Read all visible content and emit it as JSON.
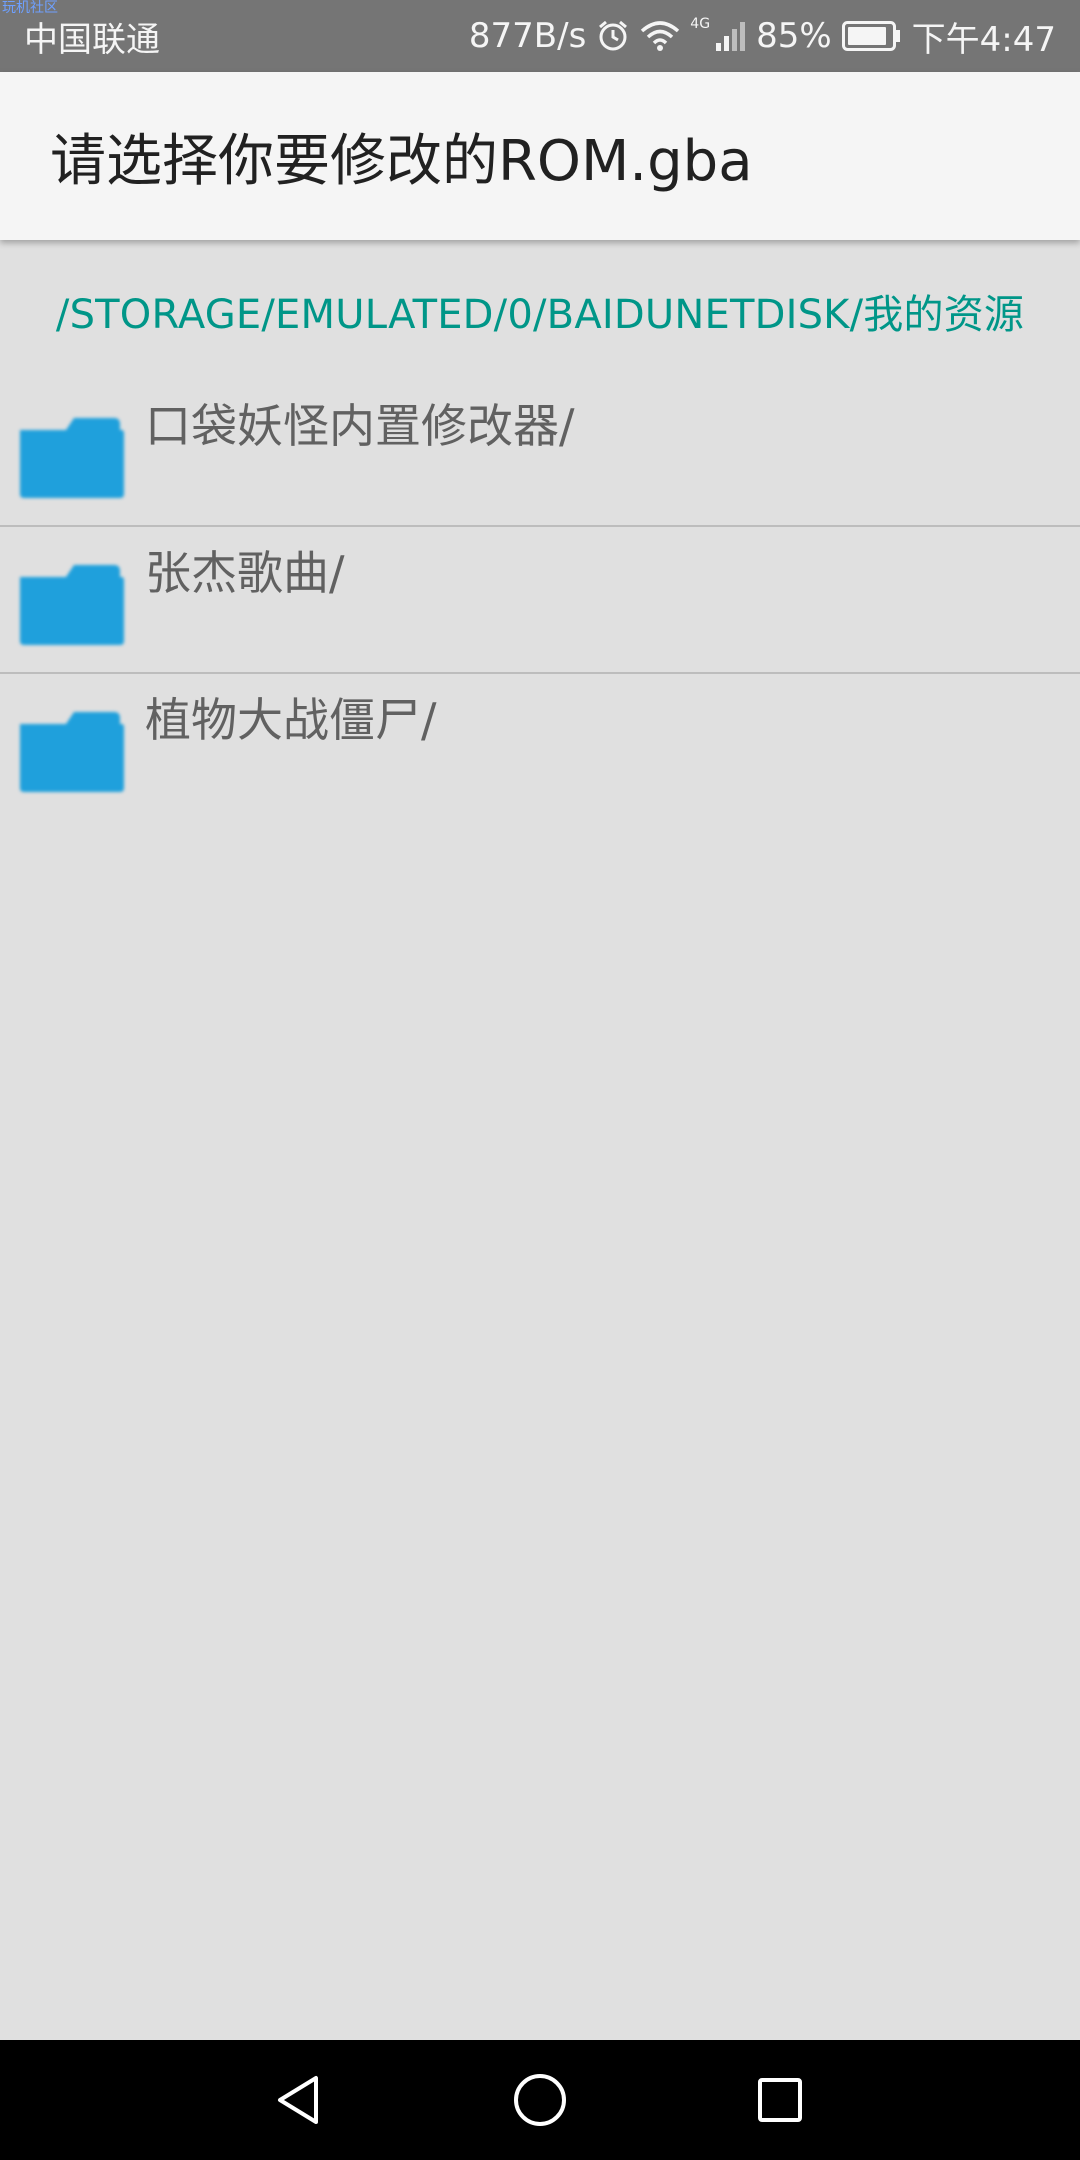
{
  "status_bar": {
    "watermark": "玩机社区",
    "carrier": "中国联通",
    "speed": "877B/s",
    "network": "4G",
    "battery": "85%",
    "time": "下午4:47"
  },
  "app_bar": {
    "title": "请选择你要修改的ROM.gba"
  },
  "path": "/STORAGE/EMULATED/0/BAIDUNETDISK/我的资源",
  "files": [
    {
      "name": "口袋妖怪内置修改器/",
      "icon": "folder-icon"
    },
    {
      "name": "张杰歌曲/",
      "icon": "folder-icon"
    },
    {
      "name": "植物大战僵尸/",
      "icon": "folder-icon"
    }
  ],
  "colors": {
    "accent": "#009688",
    "folder": "#1fa0dc",
    "status_bar": "#757575",
    "app_bar": "#f5f5f5",
    "background": "#e0e0e0"
  },
  "nav": [
    "back-icon",
    "home-icon",
    "recents-icon"
  ]
}
